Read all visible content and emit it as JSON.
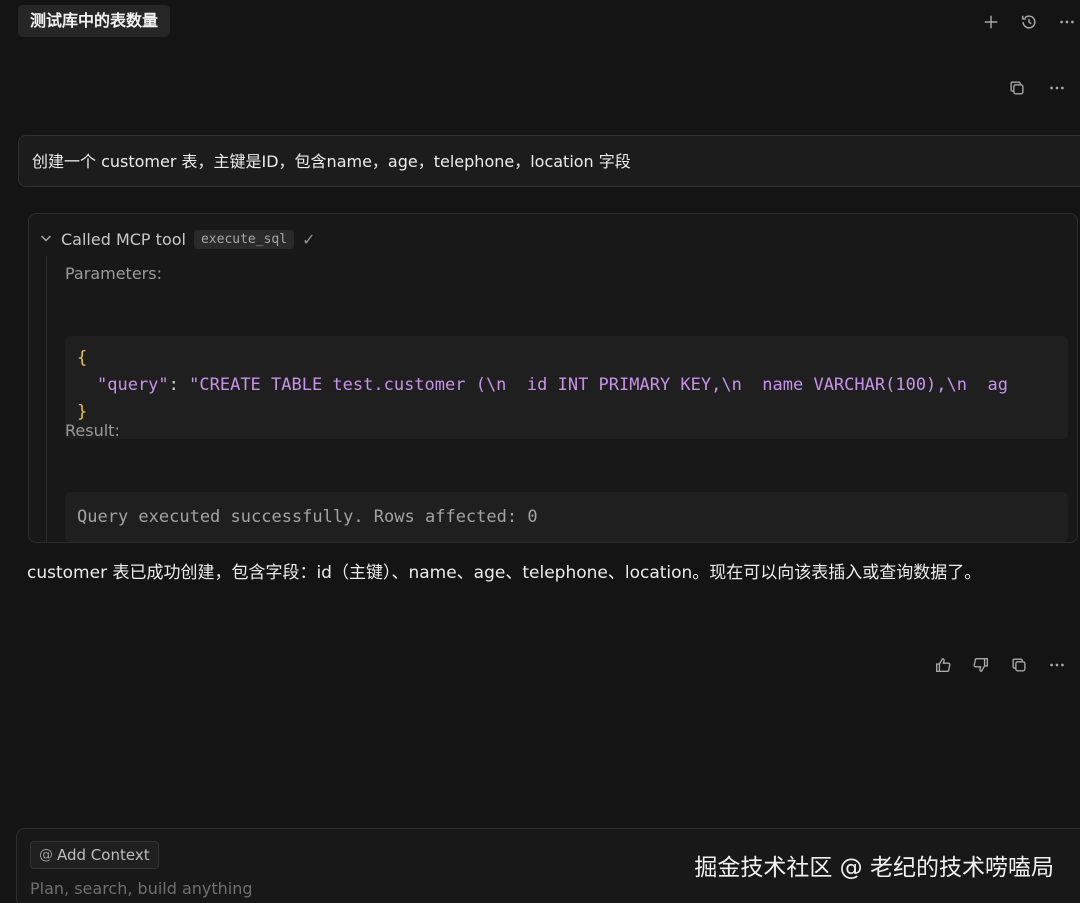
{
  "tab_title": "测试库中的表数量",
  "top_icons": [
    "plus-icon",
    "history-icon",
    "more-icon"
  ],
  "user_message": "创建一个 customer 表，主键是ID，包含name，age，telephone，location 字段",
  "tool_call": {
    "header_label": "Called MCP tool",
    "tool_name": "execute_sql",
    "parameters_label": "Parameters:",
    "code": {
      "open_brace": "{",
      "key": "\"query\"",
      "colon": ": ",
      "value": "\"CREATE TABLE test.customer (\\n  id INT PRIMARY KEY,\\n  name VARCHAR(100),\\n  ag",
      "close_brace": "}"
    },
    "result_label": "Result:",
    "result_text": "Query executed successfully. Rows affected: 0"
  },
  "assistant_message": "customer 表已成功创建，包含字段：id（主键）、name、age、telephone、location。现在可以向该表插入或查询数据了。",
  "composer": {
    "add_context_label": "Add Context",
    "placeholder": "Plan, search, build anything"
  },
  "watermark": "掘金技术社区 @ 老纪的技术唠嗑局"
}
